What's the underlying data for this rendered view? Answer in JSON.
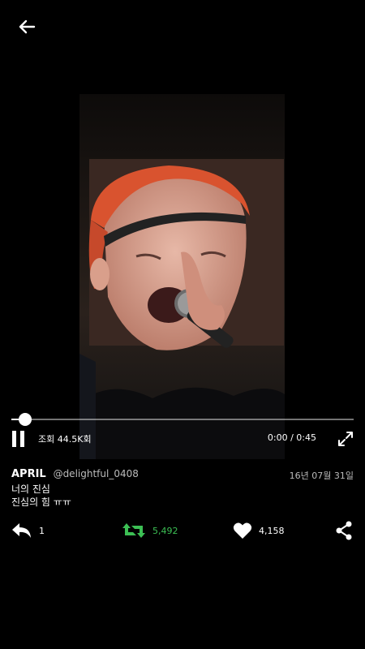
{
  "video": {
    "views_label": "조회 44.5K회",
    "time_label": "0:00 / 0:45",
    "progress": 0.04
  },
  "tweet": {
    "author": "APRIL",
    "handle": "@delightful_0408",
    "date": "16년 07월 31일",
    "line1": "너의 진심",
    "line2": "진심의 힘 ㅠㅠ"
  },
  "actions": {
    "reply_count": "1",
    "retweet_count": "5,492",
    "like_count": "4,158"
  },
  "colors": {
    "retweet_green": "#3cbf54",
    "background": "#000000"
  }
}
